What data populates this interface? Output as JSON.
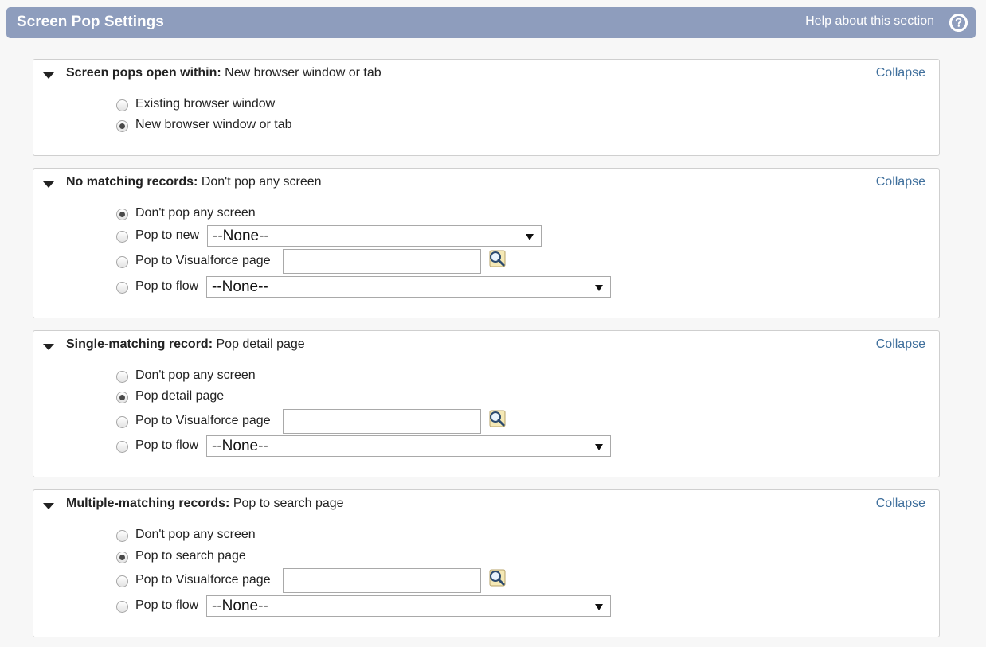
{
  "header": {
    "title": "Screen Pop Settings",
    "help_text": "Help about this section",
    "help_icon": "question-circle-icon"
  },
  "sections": [
    {
      "label": "Screen pops open within:",
      "value": "New browser window or tab",
      "collapse": "Collapse",
      "options": [
        {
          "label": "Existing browser window",
          "checked": false
        },
        {
          "label": "New browser window or tab",
          "checked": true
        }
      ]
    },
    {
      "label": "No matching records:",
      "value": "Don't pop any screen",
      "collapse": "Collapse",
      "options": [
        {
          "label": "Don't pop any screen",
          "checked": true
        },
        {
          "label": "Pop to new",
          "checked": false,
          "select": "--None--"
        },
        {
          "label": "Pop to Visualforce page",
          "checked": false,
          "input": ""
        },
        {
          "label": "Pop to flow",
          "checked": false,
          "select": "--None--"
        }
      ]
    },
    {
      "label": "Single-matching record:",
      "value": "Pop detail page",
      "collapse": "Collapse",
      "options": [
        {
          "label": "Don't pop any screen",
          "checked": false
        },
        {
          "label": "Pop detail page",
          "checked": true
        },
        {
          "label": "Pop to Visualforce page",
          "checked": false,
          "input": ""
        },
        {
          "label": "Pop to flow",
          "checked": false,
          "select": "--None--"
        }
      ]
    },
    {
      "label": "Multiple-matching records:",
      "value": "Pop to search page",
      "collapse": "Collapse",
      "options": [
        {
          "label": "Don't pop any screen",
          "checked": false
        },
        {
          "label": "Pop to search page",
          "checked": true
        },
        {
          "label": "Pop to Visualforce page",
          "checked": false,
          "input": ""
        },
        {
          "label": "Pop to flow",
          "checked": false,
          "select": "--None--"
        }
      ]
    }
  ],
  "icons": {
    "expanded": "triangle-down-icon",
    "lookup": "lookup-magnifier-icon"
  },
  "colors": {
    "header_bg": "#8e9dbd",
    "link": "#3f6f9c"
  }
}
